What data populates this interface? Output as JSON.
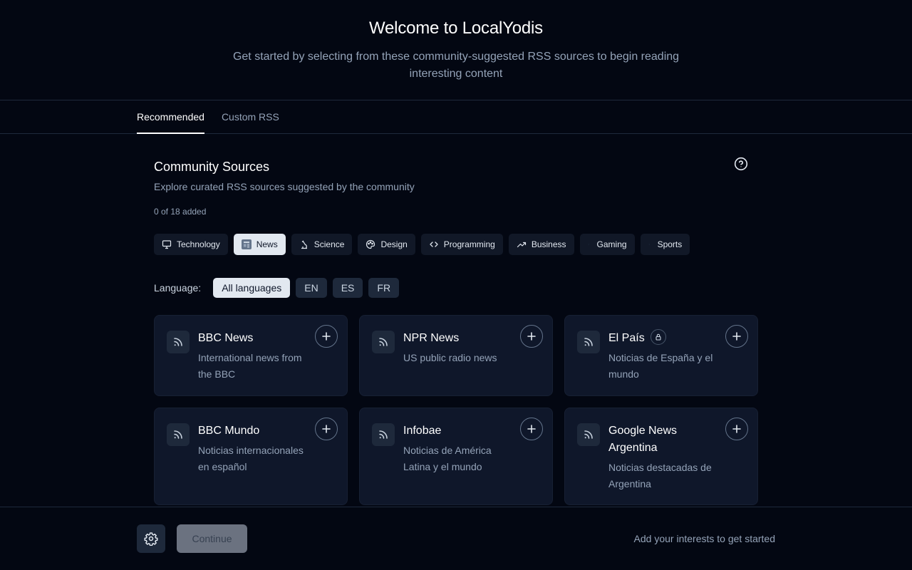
{
  "hero": {
    "title": "Welcome to LocalYodis",
    "subtitle": "Get started by selecting from these community-suggested RSS sources to begin reading interesting content"
  },
  "tabs": [
    {
      "label": "Recommended",
      "active": true
    },
    {
      "label": "Custom RSS",
      "active": false
    }
  ],
  "section": {
    "title": "Community Sources",
    "subtitle": "Explore curated RSS sources suggested by the community",
    "count": "0 of 18 added",
    "help_icon": "help-circle-icon"
  },
  "categories": [
    {
      "label": "Technology",
      "icon": "monitor-icon",
      "active": false
    },
    {
      "label": "News",
      "icon": "newspaper-icon",
      "active": true
    },
    {
      "label": "Science",
      "icon": "microscope-icon",
      "active": false
    },
    {
      "label": "Design",
      "icon": "palette-icon",
      "active": false
    },
    {
      "label": "Programming",
      "icon": "code-icon",
      "active": false
    },
    {
      "label": "Business",
      "icon": "trending-up-icon",
      "active": false
    },
    {
      "label": "Gaming",
      "icon": "",
      "active": false
    },
    {
      "label": "Sports",
      "icon": "",
      "active": false
    }
  ],
  "language": {
    "label": "Language:",
    "options": [
      {
        "label": "All languages",
        "active": true
      },
      {
        "label": "EN",
        "active": false
      },
      {
        "label": "ES",
        "active": false
      },
      {
        "label": "FR",
        "active": false
      }
    ]
  },
  "sources": [
    {
      "name": "BBC News",
      "description": "International news from the BBC",
      "locked": false
    },
    {
      "name": "NPR News",
      "description": "US public radio news",
      "locked": false
    },
    {
      "name": "El País",
      "description": "Noticias de España y el mundo",
      "locked": true
    },
    {
      "name": "BBC Mundo",
      "description": "Noticias internacionales en español",
      "locked": false
    },
    {
      "name": "Infobae",
      "description": "Noticias de América Latina y el mundo",
      "locked": false
    },
    {
      "name": "Google News Argentina",
      "description": "Noticias destacadas de Argentina",
      "locked": false
    }
  ],
  "footer": {
    "continue_label": "Continue",
    "message": "Add your interests to get started"
  },
  "colors": {
    "background": "#030712",
    "card": "#0f172a",
    "accent_active": "#e2e8f0",
    "muted_text": "#94a3b8"
  }
}
